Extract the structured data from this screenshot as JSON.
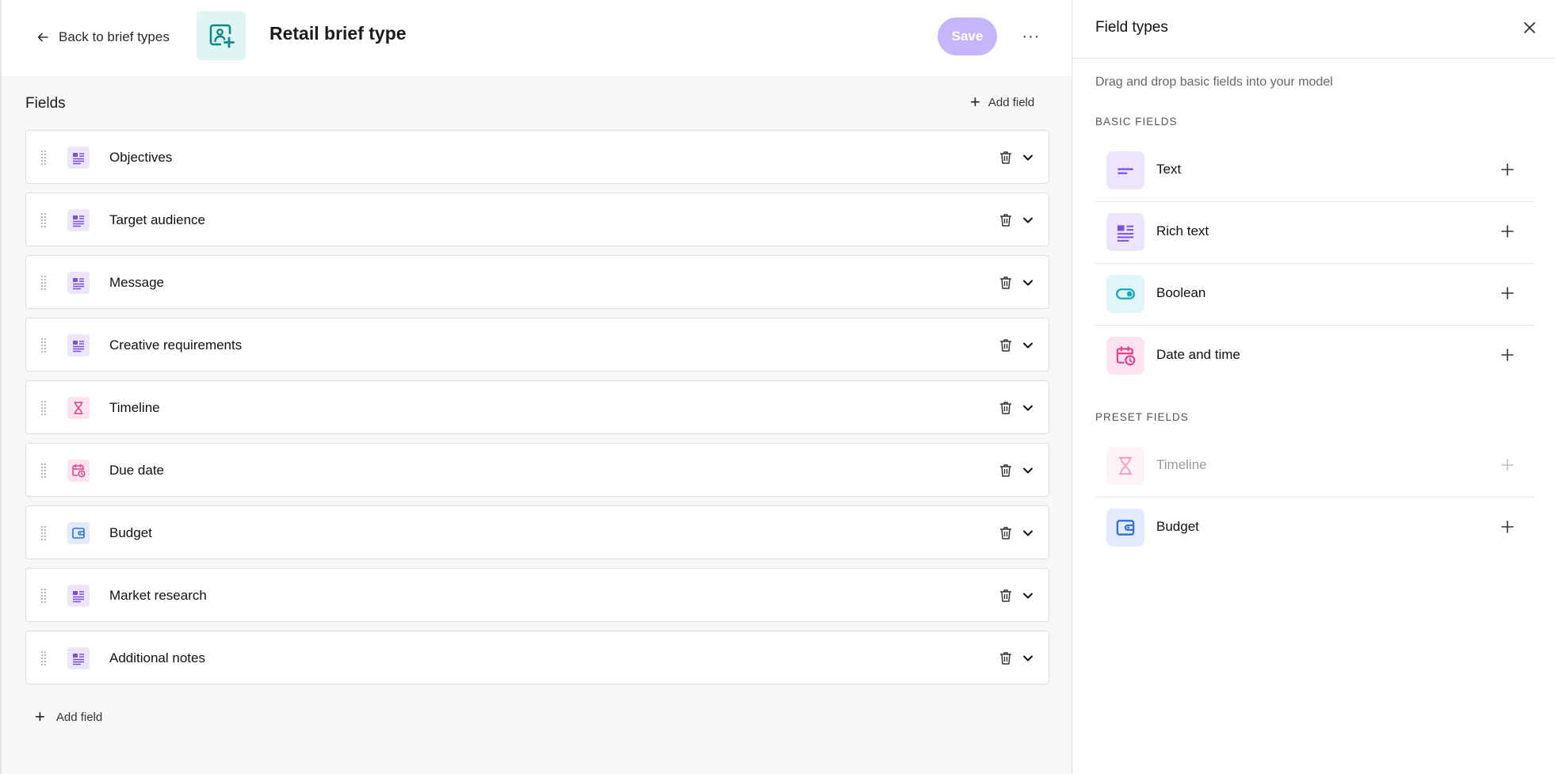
{
  "header": {
    "back_label": "Back to brief types",
    "title": "Retail brief type",
    "save_label": "Save",
    "more_label": "···"
  },
  "fields": {
    "title": "Fields",
    "add_label": "Add field",
    "items": [
      {
        "label": "Objectives",
        "icon": "rich-text-icon"
      },
      {
        "label": "Target audience",
        "icon": "rich-text-icon"
      },
      {
        "label": "Message",
        "icon": "rich-text-icon"
      },
      {
        "label": "Creative requirements",
        "icon": "rich-text-icon"
      },
      {
        "label": "Timeline",
        "icon": "hourglass-icon"
      },
      {
        "label": "Due date",
        "icon": "calendar-clock-icon"
      },
      {
        "label": "Budget",
        "icon": "wallet-icon"
      },
      {
        "label": "Market research",
        "icon": "rich-text-icon"
      },
      {
        "label": "Additional notes",
        "icon": "rich-text-icon"
      }
    ]
  },
  "panel": {
    "title": "Field types",
    "description": "Drag and drop basic fields into your model",
    "basic_label": "BASIC FIELDS",
    "basic": [
      {
        "label": "Text",
        "icon": "text-icon"
      },
      {
        "label": "Rich text",
        "icon": "rich-text-icon"
      },
      {
        "label": "Boolean",
        "icon": "toggle-icon"
      },
      {
        "label": "Date and time",
        "icon": "calendar-clock-icon"
      }
    ],
    "preset_label": "PRESET FIELDS",
    "preset": [
      {
        "label": "Timeline",
        "icon": "hourglass-icon",
        "disabled": true
      },
      {
        "label": "Budget",
        "icon": "wallet-icon",
        "disabled": false
      }
    ]
  },
  "colors": {
    "accent_purple": "#7b4fe0",
    "save_bg": "#c7b5fb",
    "teal": "#0d8a86",
    "pink": "#e0408a",
    "blue": "#2f6fd6"
  }
}
